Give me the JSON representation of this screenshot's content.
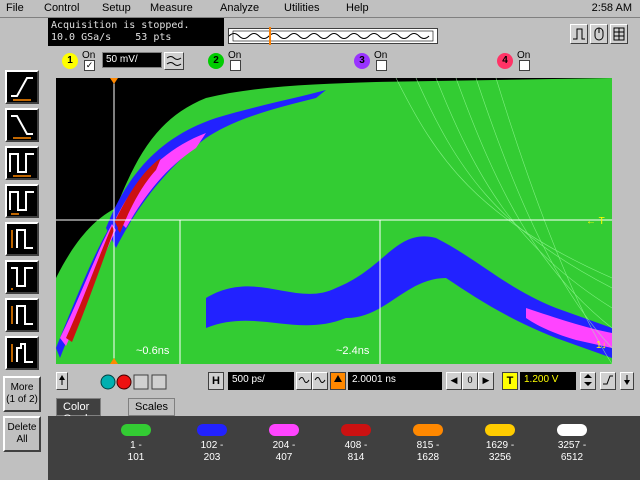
{
  "menu": [
    "File",
    "Control",
    "Setup",
    "Measure",
    "Analyze",
    "Utilities",
    "Help"
  ],
  "clock": "2:58 AM",
  "status": {
    "line1": "Acquisition is stopped.",
    "line2": "10.0 GSa/s    53 pts"
  },
  "channels": [
    {
      "num": "1",
      "on_label": "On",
      "checked": "✓",
      "color": "#ffff00"
    },
    {
      "num": "2",
      "on_label": "On",
      "checked": "",
      "color": "#00cc00"
    },
    {
      "num": "3",
      "on_label": "On",
      "checked": "",
      "color": "#9933ff"
    },
    {
      "num": "4",
      "on_label": "On",
      "checked": "",
      "color": "#ff3366"
    }
  ],
  "ch1_scale": "50 mV/",
  "side": {
    "more_label": "More\n(1 of 2)",
    "delete_label": "Delete\nAll"
  },
  "display": {
    "marker1": "~0.6ns",
    "marker2": "~2.4ns",
    "trigger_marker": "← T",
    "level_marker": "1↓"
  },
  "controls": {
    "h_tag": "H",
    "h_scale": "500 ps/",
    "t_tag": "T",
    "delay": "2.0001 ns",
    "trigger_level": "1.200 V",
    "step_left": "◀",
    "step_zero": "0",
    "step_right": "▶"
  },
  "tabs": [
    "Color Grade",
    "Scales"
  ],
  "legend": [
    {
      "range": "1 -\n101",
      "color": "#33cc33"
    },
    {
      "range": "102 -\n203",
      "color": "#2222ff"
    },
    {
      "range": "204 -\n407",
      "color": "#ff44ff"
    },
    {
      "range": "408 -\n814",
      "color": "#cc1111"
    },
    {
      "range": "815 -\n1628",
      "color": "#ff8800"
    },
    {
      "range": "1629 -\n3256",
      "color": "#ffcc00"
    },
    {
      "range": "3257 -\n6512",
      "color": "#ffffff"
    }
  ],
  "colors": {
    "green": "#33cc33",
    "blue": "#2222ff",
    "magenta": "#ff44ff",
    "red": "#cc1111",
    "orange": "#ff8800",
    "yellow": "#ffcc00"
  }
}
